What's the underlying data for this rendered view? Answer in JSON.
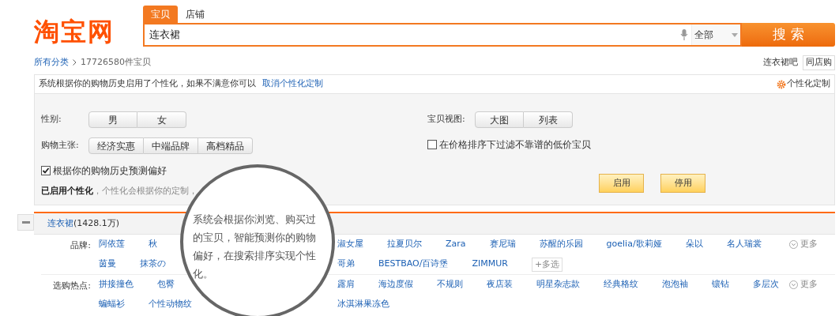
{
  "logo": "淘宝网",
  "search": {
    "tabs": [
      {
        "label": "宝贝",
        "selected": true
      },
      {
        "label": "店铺",
        "selected": false
      }
    ],
    "value": "连衣裙",
    "scope": "全部",
    "button": "搜 索"
  },
  "breadcrumb": {
    "root": "所有分类",
    "count": "17726580件宝贝"
  },
  "top_links": {
    "bar": "连衣裙吧",
    "same_store": "同店购"
  },
  "notice": {
    "text": "系统根据你的购物历史启用了个性化，如果不满意你可以",
    "link": "取消个性化定制",
    "settings": "个性化定制"
  },
  "preferences": {
    "left_groups": [
      {
        "label": "性别:",
        "options": [
          {
            "label": "男",
            "selected": false
          },
          {
            "label": "女",
            "selected": false
          }
        ]
      },
      {
        "label": "购物主张:",
        "options": [
          {
            "label": "经济实惠",
            "selected": false
          },
          {
            "label": "中端品牌",
            "selected": false
          },
          {
            "label": "高档精品",
            "selected": false
          }
        ]
      }
    ],
    "right_groups": [
      {
        "label": "宝贝视图:",
        "options": [
          {
            "label": "大图",
            "selected": false
          },
          {
            "label": "列表",
            "selected": false
          }
        ]
      }
    ],
    "history_check": {
      "label": "根据你的购物历史预测偏好",
      "checked": true
    },
    "price_check": {
      "label": "在价格排序下过滤不靠谱的低价宝贝",
      "checked": false
    },
    "status": "**已启用个性化**，个性化会根据你的定制，",
    "buttons": [
      "启用",
      "停用"
    ]
  },
  "tooltip": "系统会根据你浏览、购买过的宝贝，智能预测你的购物偏好，在搜索排序实现个性化。",
  "category": {
    "name": "连衣裙",
    "count": "(1428.1万)"
  },
  "attributes": [
    {
      "label": "品牌:",
      "more": "更多",
      "multi_select": "+多选",
      "lines": [
        {
          "items_left": [
            "阿依莲",
            "秋"
          ],
          "items_right": [
            "淑女屋",
            "拉夏贝尔",
            "Zara",
            "赛尼瑞",
            "苏醒的乐园",
            "goelia/歌莉娅",
            "朵以",
            "名人瑞裳"
          ]
        },
        {
          "items_left": [
            "茵曼",
            "抹茶の"
          ],
          "items_right": [
            "哥弟",
            "BESTBAO/百诗堡",
            "ZIMMUR"
          ]
        }
      ]
    },
    {
      "label": "选购热点:",
      "more": "更多",
      "lines": [
        {
          "items_left": [
            "拼接撞色",
            "包臀"
          ],
          "items_right": [
            "露肩",
            "海边度假",
            "不规则",
            "夜店装",
            "明星杂志款",
            "经典格纹",
            "泡泡袖",
            "镶钻",
            "多层次"
          ]
        },
        {
          "items_left": [
            "蝙蝠衫",
            "个性动物纹"
          ],
          "items_right": [
            "冰淇淋果冻色"
          ]
        }
      ]
    }
  ]
}
